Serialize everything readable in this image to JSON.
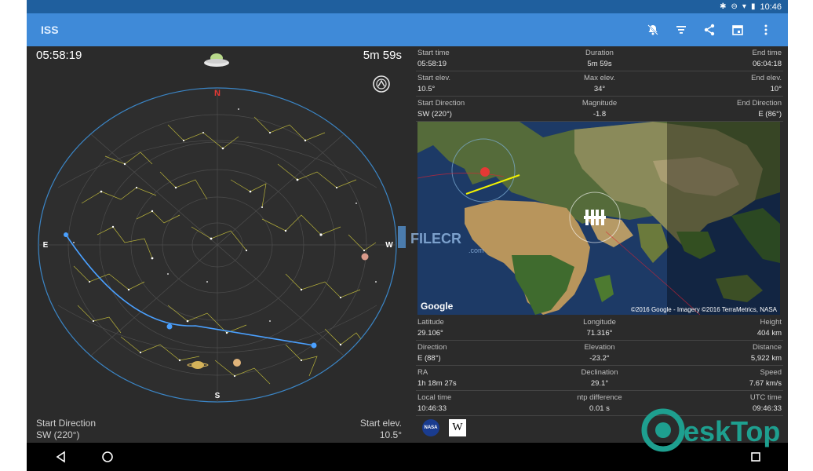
{
  "status_bar": {
    "time": "10:46",
    "icons": [
      "bluetooth-icon",
      "dnd-icon",
      "wifi-icon",
      "battery-icon"
    ]
  },
  "app_bar": {
    "title": "ISS",
    "actions": [
      "notifications-off-icon",
      "filter-icon",
      "share-icon",
      "calendar-icon",
      "more-vert-icon"
    ]
  },
  "sky": {
    "current_time": "05:58:19",
    "duration_left": "5m 59s",
    "compass": {
      "n": "N",
      "e": "E",
      "w": "W",
      "s": "S"
    },
    "start_direction_label": "Start Direction",
    "start_direction_value": "SW (220°)",
    "start_elev_label": "Start elev.",
    "start_elev_value": "10.5°"
  },
  "pass_info": [
    {
      "left_label": "Start time",
      "left_value": "05:58:19",
      "center_label": "Duration",
      "center_value": "5m 59s",
      "right_label": "End time",
      "right_value": "06:04:18"
    },
    {
      "left_label": "Start elev.",
      "left_value": "10.5°",
      "center_label": "Max elev.",
      "center_value": "34°",
      "right_label": "End elev.",
      "right_value": "10°"
    },
    {
      "left_label": "Start Direction",
      "left_value": "SW (220°)",
      "center_label": "Magnitude",
      "center_value": "-1.8",
      "right_label": "End Direction",
      "right_value": "E (86°)"
    }
  ],
  "map": {
    "provider": "Google",
    "credit": "©2016 Google - Imagery ©2016 TerraMetrics, NASA"
  },
  "position_info": [
    {
      "left_label": "Latitude",
      "left_value": "29.106°",
      "center_label": "Longitude",
      "center_value": "71.316°",
      "right_label": "Height",
      "right_value": "404 km"
    },
    {
      "left_label": "Direction",
      "left_value": "E (88°)",
      "center_label": "Elevation",
      "center_value": "-23.2°",
      "right_label": "Distance",
      "right_value": "5,922 km"
    },
    {
      "left_label": "RA",
      "left_value": "1h 18m 27s",
      "center_label": "Declination",
      "center_value": "29.1°",
      "right_label": "Speed",
      "right_value": "7.67 km/s"
    },
    {
      "left_label": "Local time",
      "left_value": "10:46:33",
      "center_label": "ntp difference",
      "center_value": "0.01 s",
      "right_label": "UTC time",
      "right_value": "09:46:33"
    }
  ],
  "links": {
    "nasa": "NASA",
    "wiki": "W"
  },
  "watermark": {
    "text": "eskTop",
    "filecr": "FILECR",
    "filecr_sub": ".com"
  },
  "colors": {
    "app_bar": "#3f8ad8",
    "status_bar": "#1f5f9e",
    "background": "#2b2b2b",
    "track": "#4aa0ff",
    "north": "#e53935"
  }
}
